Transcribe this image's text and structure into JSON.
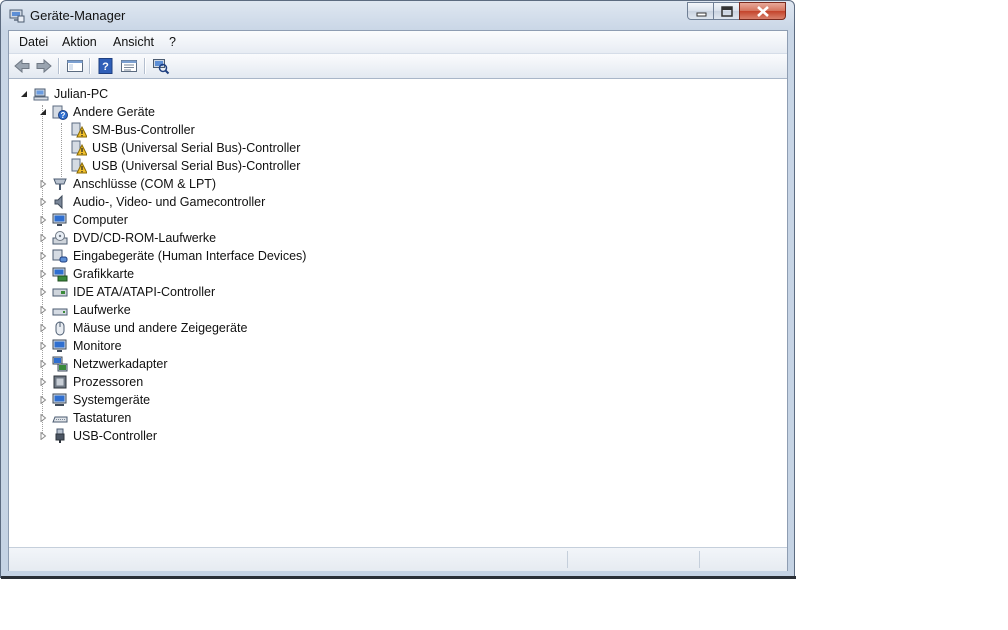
{
  "window": {
    "title": "Geräte-Manager",
    "icon": "device-manager-icon"
  },
  "menu": [
    "Datei",
    "Aktion",
    "Ansicht",
    "?"
  ],
  "toolbar": {
    "icons": [
      "back-arrow-icon",
      "forward-arrow-icon",
      "show-hide-console-tree-icon",
      "help-icon",
      "properties-icon",
      "scan-hardware-icon"
    ]
  },
  "tree": {
    "root": "Julian-PC",
    "other_devices": {
      "label": "Andere Geräte",
      "children": [
        "SM-Bus-Controller",
        "USB (Universal Serial Bus)-Controller",
        "USB (Universal Serial Bus)-Controller"
      ]
    },
    "categories": [
      "Anschlüsse (COM & LPT)",
      "Audio-, Video- und Gamecontroller",
      "Computer",
      "DVD/CD-ROM-Laufwerke",
      "Eingabegeräte (Human Interface Devices)",
      "Grafikkarte",
      "IDE ATA/ATAPI-Controller",
      "Laufwerke",
      "Mäuse und andere Zeigegeräte",
      "Monitore",
      "Netzwerkadapter",
      "Prozessoren",
      "Systemgeräte",
      "Tastaturen",
      "USB-Controller"
    ]
  },
  "colors": {
    "warning": "#f2c12e",
    "selection_accent": "#3a7bd5"
  }
}
